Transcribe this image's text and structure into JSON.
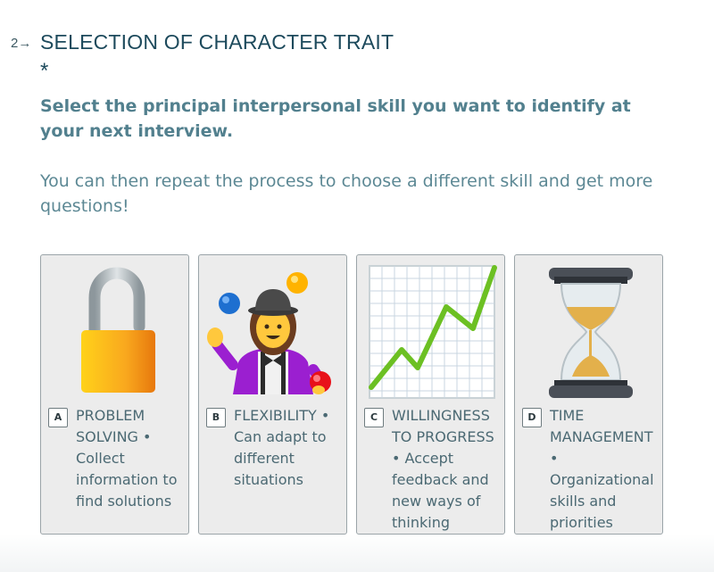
{
  "question": {
    "number": "2",
    "arrow": "→",
    "title": "SELECTION OF CHARACTER TRAIT",
    "required_mark": "*",
    "description": "Select the principal interpersonal skill you want to identify at your next interview.",
    "subtext": "You can then repeat the process to choose a different skill and get more questions!"
  },
  "choices": [
    {
      "key": "A",
      "label": "PROBLEM SOLVING • Collect information to find solutions",
      "icon": "open-padlock-icon"
    },
    {
      "key": "B",
      "label": "FLEXIBILITY • Can adapt to different situations",
      "icon": "juggling-woman-icon"
    },
    {
      "key": "C",
      "label": "WILLINGNESS TO PROGRESS • Accept feedback and new ways of thinking",
      "icon": "chart-increasing-icon"
    },
    {
      "key": "D",
      "label": "TIME MANAGEMENT • Organizational skills and priorities",
      "icon": "hourglass-icon"
    }
  ]
}
